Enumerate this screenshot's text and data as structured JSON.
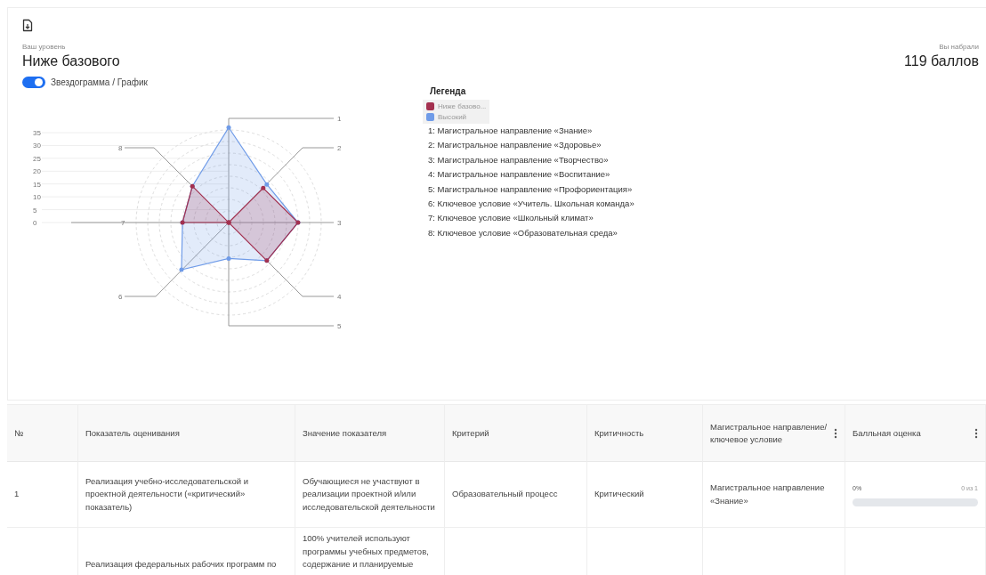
{
  "header": {
    "level_caption": "Ваш уровень",
    "level": "Ниже базового",
    "score_caption": "Вы набрали",
    "score": "119 баллов"
  },
  "toggle": {
    "label": "Звездограмма / График",
    "on": true
  },
  "radar": {
    "scale_labels": [
      "35",
      "30",
      "25",
      "20",
      "15",
      "10",
      "5",
      "0"
    ],
    "axis_labels": [
      "1",
      "8",
      "2",
      "7",
      "3",
      "6",
      "4",
      "5"
    ]
  },
  "legend": {
    "title": "Легенда",
    "series": [
      {
        "name": "Ниже базово...",
        "color": "#a3304f"
      },
      {
        "name": "Высокий",
        "color": "#6f9be8"
      }
    ],
    "axes": [
      "1: Магистральное направление «Знание»",
      "2: Магистральное направление «Здоровье»",
      "3: Магистральное направление «Творчество»",
      "4: Магистральное направление «Воспитание»",
      "5: Магистральное направление «Профориентация»",
      "6: Ключевое условие «Учитель. Школьная команда»",
      "7: Ключевое условие «Школьный климат»",
      "8: Ключевое условие «Образовательная среда»"
    ]
  },
  "table": {
    "columns": [
      {
        "label": "№",
        "menu": false
      },
      {
        "label": "Показатель оценивания",
        "menu": false
      },
      {
        "label": "Значение показателя",
        "menu": false
      },
      {
        "label": "Критерий",
        "menu": false
      },
      {
        "label": "Критичность",
        "menu": false
      },
      {
        "label": "Магистральное направление/ключевое условие",
        "menu": true
      },
      {
        "label": "Балльная оценка",
        "menu": true
      }
    ],
    "rows": [
      {
        "number": "1",
        "indicator": "Реализация учебно-исследовательской и проектной деятельности («критический» показатель)",
        "value": "Обучающиеся не участвуют в реализации проектной и/или исследовательской деятельности",
        "criterion": "Образовательный процесс",
        "criticality": "Критический",
        "direction": "Магистральное направление «Знание»",
        "percent": "0%",
        "points": "0 из 1",
        "level": 0
      },
      {
        "number": "",
        "indicator": "Реализация федеральных рабочих программ по",
        "value": "100% учителей используют программы учебных предметов, содержание и планируемые",
        "criterion": "",
        "criticality": "",
        "direction": ""
      }
    ]
  }
}
